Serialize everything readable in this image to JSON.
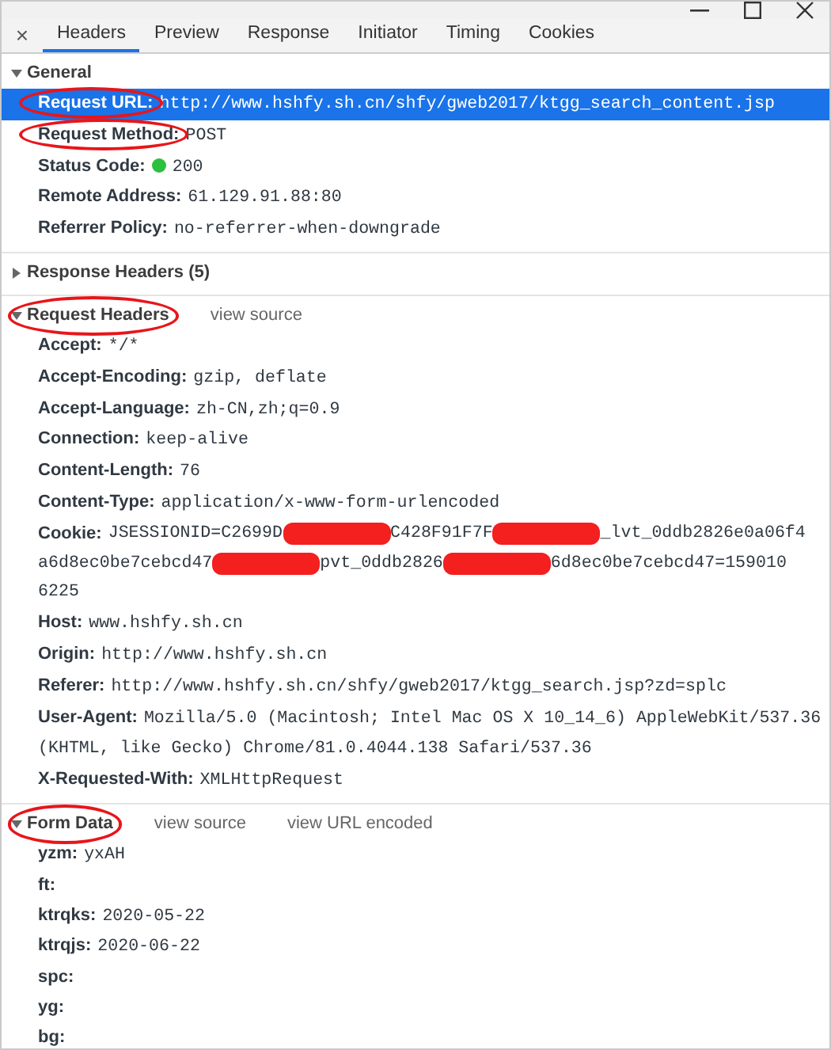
{
  "tabs": [
    {
      "label": "Headers",
      "selected": true
    },
    {
      "label": "Preview",
      "selected": false
    },
    {
      "label": "Response",
      "selected": false
    },
    {
      "label": "Initiator",
      "selected": false
    },
    {
      "label": "Timing",
      "selected": false
    },
    {
      "label": "Cookies",
      "selected": false
    }
  ],
  "close_tab": "×",
  "sections": [
    {
      "title": "General",
      "expanded": true,
      "circled": false,
      "rows": [
        {
          "name": "Request URL:",
          "value": "http://www.hshfy.sh.cn/shfy/gweb2017/ktgg_search_content.jsp",
          "selected": true,
          "circled": true
        },
        {
          "name": "Request Method:",
          "value": "POST",
          "selected": false,
          "circled": true
        },
        {
          "name": "Status Code:",
          "value": "200",
          "selected": false,
          "circled": false,
          "color": "#2bc03e"
        },
        {
          "name": "Remote Address:",
          "value": "61.129.91.88:80",
          "selected": false,
          "circled": false
        },
        {
          "name": "Referrer Policy:",
          "value": "no-referrer-when-downgrade",
          "selected": false,
          "circled": false
        }
      ]
    },
    {
      "title": "Response Headers (5)",
      "expanded": false,
      "circled": false
    },
    {
      "title": "Request Headers",
      "expanded": true,
      "circled": true,
      "links": [
        "view source"
      ],
      "rows": [
        {
          "name": "Accept:",
          "value": "*/*",
          "selected": false,
          "circled": false
        },
        {
          "name": "Accept-Encoding:",
          "value": "gzip, deflate",
          "selected": false,
          "circled": false
        },
        {
          "name": "Accept-Language:",
          "value": "zh-CN,zh;q=0.9",
          "selected": false,
          "circled": false
        },
        {
          "name": "Connection:",
          "value": "keep-alive",
          "selected": false,
          "circled": false
        },
        {
          "name": "Content-Length:",
          "value": "76",
          "selected": false,
          "circled": false
        },
        {
          "name": "Content-Type:",
          "value": "application/x-www-form-urlencoded",
          "selected": false,
          "circled": false
        },
        {
          "name": "Cookie:",
          "selected": false,
          "circled": false,
          "value_lines": [
            [
              {
                "kind": "text",
                "text": "JSESSIONID=C2699D"
              },
              {
                "kind": "redacted"
              },
              {
                "kind": "text",
                "text": "C428F91F7F"
              },
              {
                "kind": "redacted"
              },
              {
                "kind": "text",
                "text": "_lvt_0ddb2826e0a06f4"
              }
            ],
            [
              {
                "kind": "text",
                "text": "a6d8ec0be7cebcd47"
              },
              {
                "kind": "redacted"
              },
              {
                "kind": "text",
                "text": "pvt_0ddb2826"
              },
              {
                "kind": "redacted"
              },
              {
                "kind": "text",
                "text": "6d8ec0be7cebcd47=159010"
              }
            ],
            [
              {
                "kind": "text",
                "text": "6225"
              }
            ]
          ]
        },
        {
          "name": "Host:",
          "value": "www.hshfy.sh.cn",
          "selected": false,
          "circled": false
        },
        {
          "name": "Origin:",
          "value": "http://www.hshfy.sh.cn",
          "selected": false,
          "circled": false
        },
        {
          "name": "Referer:",
          "value": "http://www.hshfy.sh.cn/shfy/gweb2017/ktgg_search.jsp?zd=splc",
          "selected": false,
          "circled": false
        },
        {
          "name": "User-Agent:",
          "value": "Mozilla/5.0 (Macintosh; Intel Mac OS X 10_14_6) AppleWebKit/537.36 (KHTML, like Gecko) Chrome/81.0.4044.138 Safari/537.36",
          "selected": false,
          "circled": false
        },
        {
          "name": "X-Requested-With:",
          "value": "XMLHttpRequest",
          "selected": false,
          "circled": false
        }
      ]
    },
    {
      "title": "Form Data",
      "expanded": true,
      "circled": true,
      "links": [
        "view source",
        "view URL encoded"
      ],
      "rows": [
        {
          "name": "yzm:",
          "value": "yxAH",
          "selected": false,
          "circled": false
        },
        {
          "name": "ft:",
          "selected": false,
          "circled": false
        },
        {
          "name": "ktrqks:",
          "value": "2020-05-22",
          "selected": false,
          "circled": false
        },
        {
          "name": "ktrqjs:",
          "value": "2020-06-22",
          "selected": false,
          "circled": false
        },
        {
          "name": "spc:",
          "selected": false,
          "circled": false
        },
        {
          "name": "yg:",
          "selected": false,
          "circled": false
        },
        {
          "name": "bg:",
          "selected": false,
          "circled": false
        }
      ]
    }
  ]
}
